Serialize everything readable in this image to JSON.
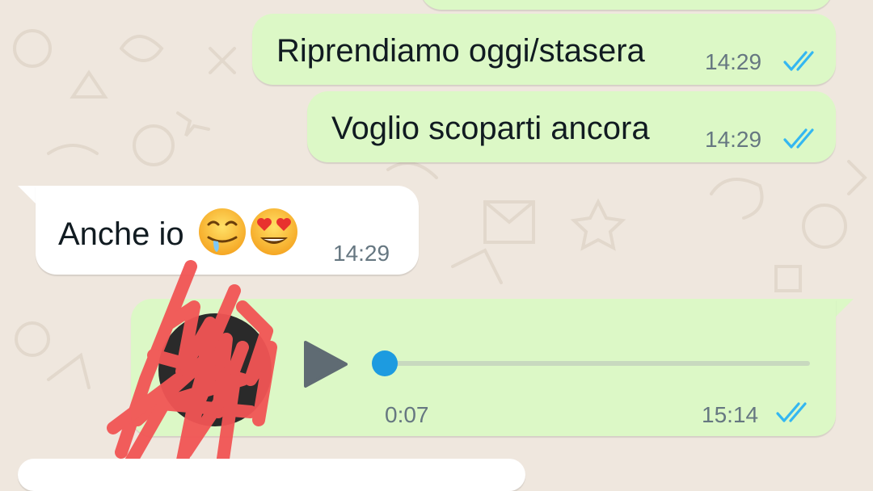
{
  "messages": [
    {
      "direction": "outgoing",
      "text": "Riprendiamo oggi/stasera",
      "time": "14:29",
      "status": "read"
    },
    {
      "direction": "outgoing",
      "text": "Voglio scoparti ancora",
      "time": "14:29",
      "status": "read"
    },
    {
      "direction": "incoming",
      "text": "Anche io",
      "emoji": [
        "drooling-face",
        "heart-eyes-face"
      ],
      "time": "14:29"
    }
  ],
  "voice_note": {
    "direction": "outgoing",
    "duration": "0:07",
    "time": "15:14",
    "status": "read",
    "progress": 0,
    "icon": "play-icon"
  },
  "colors": {
    "background": "#efe7de",
    "outgoing_bubble": "#dcf8c6",
    "incoming_bubble": "#ffffff",
    "read_ticks": "#34b7f1",
    "knob": "#1d9be0",
    "redaction": "#f25555"
  }
}
